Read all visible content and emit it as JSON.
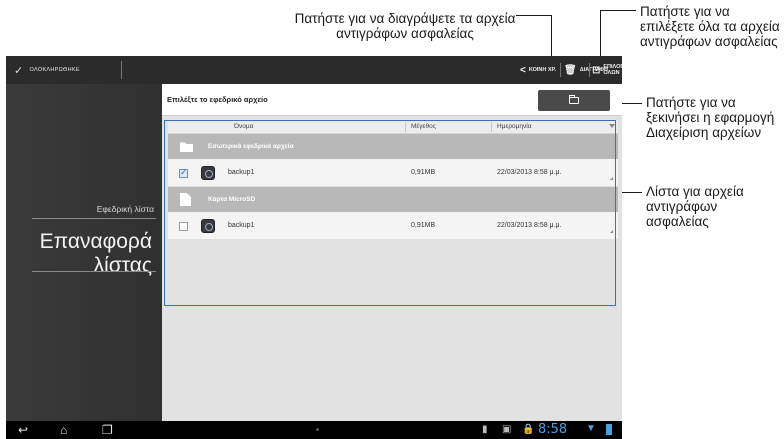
{
  "annotations": {
    "delete": "Πατήστε για να διαγράψετε τα αρχεία αντιγράφων ασφαλείας",
    "select_all": "Πατήστε για να επιλέξετε όλα τα αρχεία αντιγράφων ασφαλείας",
    "file_manager": "Πατήστε για να ξεκινήσει η εφαρμογή Διαχείριση αρχείων",
    "list": "Λίστα για αρχεία αντιγράφων ασφαλείας"
  },
  "action_bar": {
    "done_label": "ΟΛΟΚΛΗΡΩΘΗΚΕ",
    "share_label": "ΚΟΙΝΗ ΧΡ.",
    "delete_label": "ΔΙΑΓΡΑΦΗ",
    "select_all_label": "ΕΠΙΛΟΓΗ ΟΛΩΝ"
  },
  "sidebar": {
    "backup_list": "Εφεδρική λίστα",
    "restore_list": "Επαναφορά λίστας"
  },
  "main": {
    "title": "Επιλέξτε το εφεδρικό αρχείο",
    "columns": {
      "name": "Όνομα",
      "size": "Μέγεθος",
      "date": "Ημερομηνία"
    },
    "groups": [
      {
        "label": "Εσωτερικά εφεδρικά αρχεία",
        "rows": [
          {
            "name": "backup1",
            "size": "0,91MB",
            "date": "22/03/2013 8:58 μ.μ.",
            "checked": true
          }
        ]
      },
      {
        "label": "Κάρτα MicroSD",
        "rows": [
          {
            "name": "backup1",
            "size": "0,91MB",
            "date": "22/03/2013 8:58 μ.μ.",
            "checked": false
          }
        ]
      }
    ]
  },
  "status_bar": {
    "time": "8:58"
  },
  "colors": {
    "accent": "#3d70b8",
    "clock": "#4a9edb",
    "actionbar": "#2b2b2b",
    "sidebar": "#353535"
  }
}
